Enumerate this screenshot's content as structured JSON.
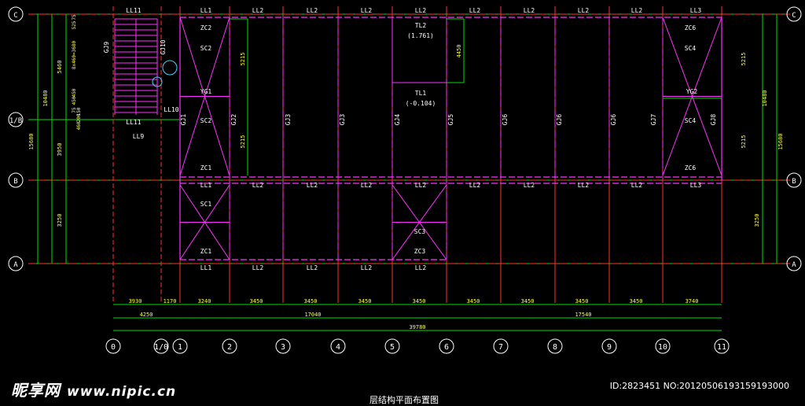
{
  "axes_x": [
    "0",
    "1/0",
    "1",
    "2",
    "3",
    "4",
    "5",
    "6",
    "7",
    "8",
    "9",
    "10",
    "11"
  ],
  "axes_y": [
    "C",
    "1/B",
    "B",
    "A"
  ],
  "beams_top": [
    "LL11",
    "LL1",
    "LL2",
    "LL2",
    "LL2",
    "LL2",
    "LL2",
    "LL2",
    "LL2",
    "LL2",
    "LL3"
  ],
  "beams_mid": [
    "LL1",
    "LL2",
    "LL2",
    "LL2",
    "LL2",
    "LL2",
    "LL2",
    "LL2",
    "LL2",
    "LL3"
  ],
  "beams_bot": [
    "LL1",
    "LL2",
    "LL2",
    "LL2",
    "LL2"
  ],
  "frames": [
    "GJ1",
    "GJ2",
    "GJ3",
    "GJ3",
    "GJ4",
    "GJ5",
    "GJ6",
    "GJ6",
    "GJ6",
    "GJ7",
    "GJ8"
  ],
  "left_labels": [
    "GJ9",
    "GJ10",
    "LL10",
    "LL11",
    "LL9"
  ],
  "braces": [
    "ZC2",
    "SC2",
    "YG1",
    "SC2",
    "ZC1",
    "SC1",
    "ZC1",
    "ZC6",
    "SC4",
    "YG2",
    "SC4",
    "ZC6",
    "SC3",
    "ZC3"
  ],
  "platforms": [
    "TL2",
    "(1.761)",
    "TL1",
    "(-0.104)"
  ],
  "stair_dims": [
    "525",
    "75",
    "8x460=3680",
    "450",
    "450",
    "75",
    "200",
    "460",
    "150"
  ],
  "dims_left": [
    "5460",
    "10480",
    "3950",
    "3250",
    "15680"
  ],
  "dims_right": [
    "5215",
    "10480",
    "5215",
    "3250",
    "15680"
  ],
  "dims_inner": [
    "5215",
    "5215",
    "4450"
  ],
  "dims_row1": [
    "3930",
    "1170",
    "3240",
    "3450",
    "3450",
    "3450",
    "3450",
    "3450",
    "3450",
    "3450",
    "3450",
    "3740"
  ],
  "dims_row2": [
    "4250",
    "17040",
    "17540"
  ],
  "dims_total": "39780",
  "watermark": {
    "cn": "昵享网",
    "url": "www.nipic.cn"
  },
  "image_id": "ID:2823451 NO:20120506193159193000",
  "caption": "层结构平面布置图"
}
